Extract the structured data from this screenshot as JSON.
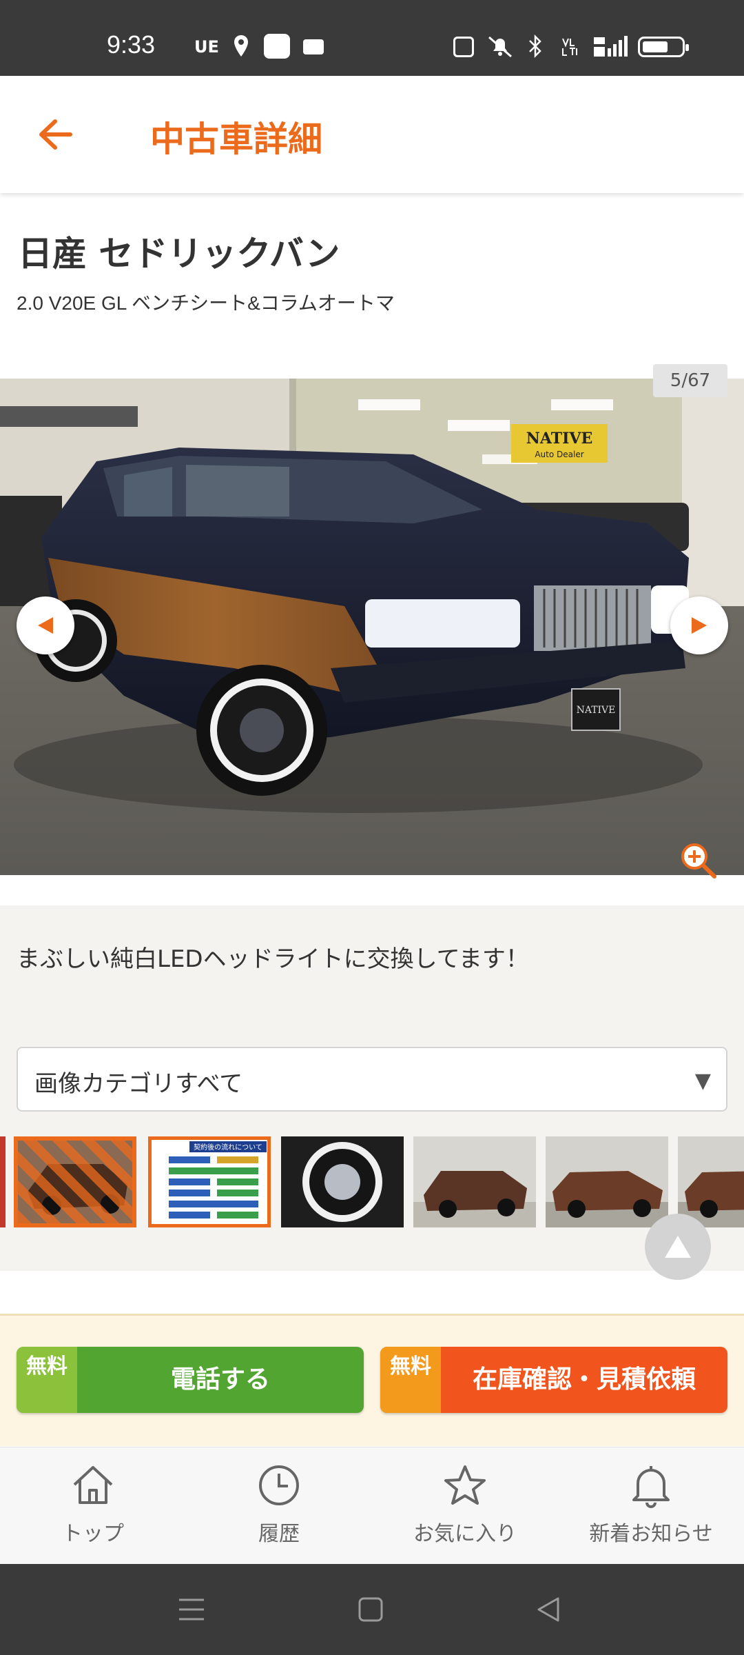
{
  "status_bar": {
    "time": "9:33",
    "carrier": "UE"
  },
  "header": {
    "title": "中古車詳細"
  },
  "car": {
    "name": "日産 セドリックバン",
    "grade": "2.0 V20E GL ベンチシート&コラムオートマ"
  },
  "gallery": {
    "counter": "5/67",
    "caption": "まぶしい純白LEDヘッドライトに交換してます！",
    "category_selected": "画像カテゴリすべて",
    "sign_text": "NATIVE",
    "sign_sub": "Auto Dealer",
    "plate_text": "NATIVE",
    "thumb2_title": "契約後の流れについて"
  },
  "cta": {
    "free_label": "無料",
    "call_label": "電話する",
    "stock_label": "在庫確認・見積依頼"
  },
  "bottom_nav": {
    "items": [
      {
        "label": "トップ",
        "icon": "home-icon"
      },
      {
        "label": "履歴",
        "icon": "clock-icon"
      },
      {
        "label": "お気に入り",
        "icon": "star-icon"
      },
      {
        "label": "新着お知らせ",
        "icon": "bell-icon"
      }
    ]
  },
  "colors": {
    "accent": "#ec6a1c",
    "call_green": "#53a532",
    "stock_orange": "#f1541c"
  }
}
